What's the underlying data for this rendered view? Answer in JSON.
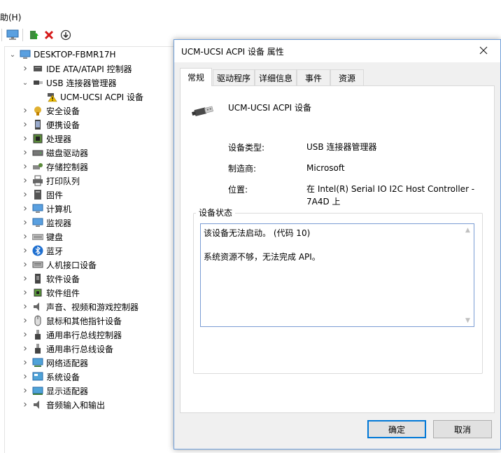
{
  "menubar": {
    "help_label": "助(H)"
  },
  "toolbar": {
    "icons": [
      "monitor-icon",
      "update-driver-icon",
      "uninstall-icon",
      "scan-hardware-icon"
    ]
  },
  "tree": {
    "root": "DESKTOP-FBMR17H",
    "items": [
      {
        "label": "IDE ATA/ATAPI 控制器",
        "icon": "ide-controller-icon"
      },
      {
        "label": "USB 连接器管理器",
        "icon": "usb-connector-icon",
        "expanded": true
      },
      {
        "label": "UCM-UCSI ACPI 设备",
        "icon": "warning-device-icon",
        "child": true
      },
      {
        "label": "安全设备",
        "icon": "security-device-icon"
      },
      {
        "label": "便携设备",
        "icon": "portable-device-icon"
      },
      {
        "label": "处理器",
        "icon": "processor-icon"
      },
      {
        "label": "磁盘驱动器",
        "icon": "disk-drive-icon"
      },
      {
        "label": "存储控制器",
        "icon": "storage-controller-icon"
      },
      {
        "label": "打印队列",
        "icon": "print-queue-icon"
      },
      {
        "label": "固件",
        "icon": "firmware-icon"
      },
      {
        "label": "计算机",
        "icon": "computer-icon"
      },
      {
        "label": "监视器",
        "icon": "monitor-icon"
      },
      {
        "label": "键盘",
        "icon": "keyboard-icon"
      },
      {
        "label": "蓝牙",
        "icon": "bluetooth-icon"
      },
      {
        "label": "人机接口设备",
        "icon": "hid-icon"
      },
      {
        "label": "软件设备",
        "icon": "software-device-icon"
      },
      {
        "label": "软件组件",
        "icon": "software-component-icon"
      },
      {
        "label": "声音、视频和游戏控制器",
        "icon": "sound-icon"
      },
      {
        "label": "鼠标和其他指针设备",
        "icon": "mouse-icon"
      },
      {
        "label": "通用串行总线控制器",
        "icon": "usb-icon"
      },
      {
        "label": "通用串行总线设备",
        "icon": "usb-icon"
      },
      {
        "label": "网络适配器",
        "icon": "network-adapter-icon"
      },
      {
        "label": "系统设备",
        "icon": "system-device-icon"
      },
      {
        "label": "显示适配器",
        "icon": "display-adapter-icon"
      },
      {
        "label": "音频输入和输出",
        "icon": "audio-io-icon"
      }
    ]
  },
  "dialog": {
    "title": "UCM-UCSI ACPI 设备 属性",
    "tabs": [
      "常规",
      "驱动程序",
      "详细信息",
      "事件",
      "资源"
    ],
    "active_tab": "常规",
    "device_name": "UCM-UCSI ACPI 设备",
    "device_type_label": "设备类型:",
    "device_type_value": "USB 连接器管理器",
    "manufacturer_label": "制造商:",
    "manufacturer_value": "Microsoft",
    "location_label": "位置:",
    "location_value_line1": "在 Intel(R) Serial IO I2C Host Controller -",
    "location_value_line2": "7A4D 上",
    "status_group_label": "设备状态",
    "status_line1": "该设备无法启动。 (代码 10)",
    "status_line2": "系统资源不够，无法完成 API。",
    "ok_label": "确定",
    "cancel_label": "取消"
  },
  "colors": {
    "accent": "#0078d7",
    "warning": "#f0c000",
    "uninstall": "#d61a1a"
  }
}
